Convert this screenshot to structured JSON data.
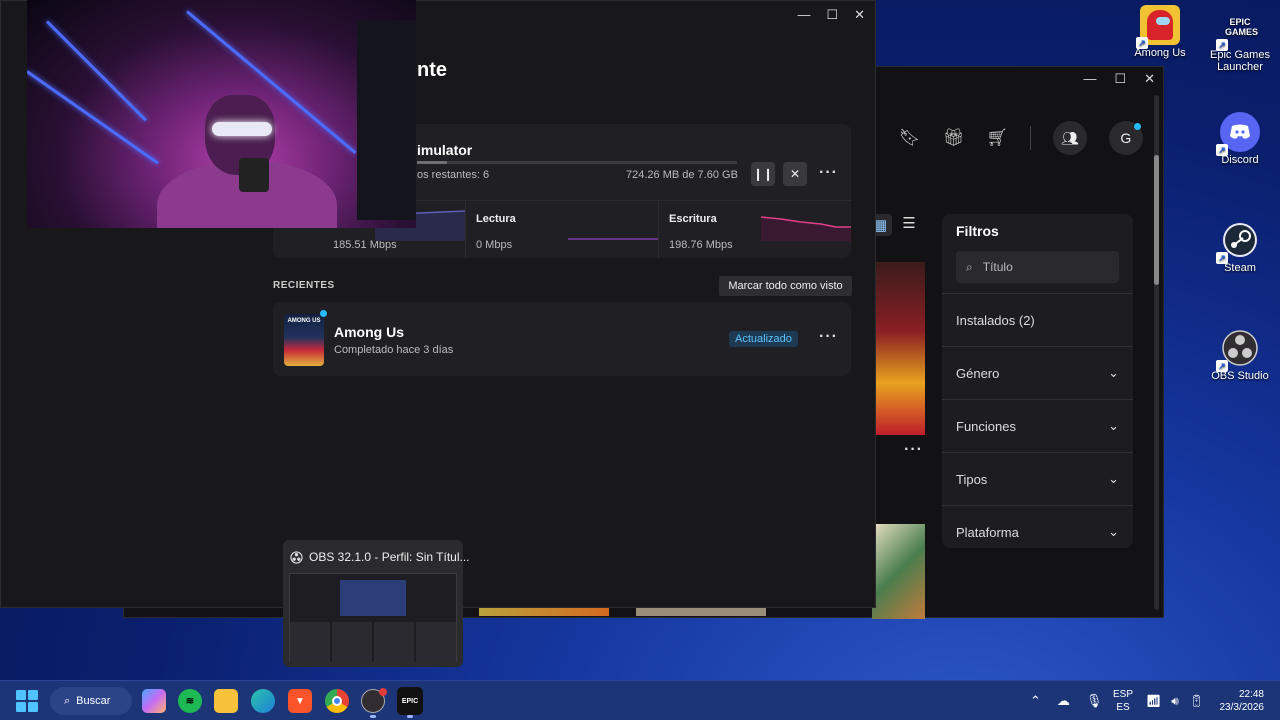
{
  "desktop": {
    "icons": [
      {
        "label": "Among Us",
        "icon": "among-us-icon"
      },
      {
        "label": "Epic Games Launcher",
        "badge": "EPIC GAMES",
        "icon": "epic-games-icon"
      },
      {
        "label": "Discord",
        "icon": "discord-icon"
      },
      {
        "label": "Steam",
        "icon": "steam-icon"
      },
      {
        "label": "OBS Studio",
        "icon": "obs-icon"
      }
    ]
  },
  "epic_library": {
    "avatar_initial": "G",
    "filters": {
      "title": "Filtros",
      "search_placeholder": "Título",
      "installed": "Instalados (2)",
      "sections": [
        "Género",
        "Funciones",
        "Tipos",
        "Plataforma"
      ]
    }
  },
  "downloads": {
    "title_fragment": "nte",
    "active": {
      "name_fragment": "imulator",
      "remaining": "os restantes: 6",
      "size": "724.26 MB de 7.60 GB",
      "progress": 0.095,
      "stats": [
        {
          "label": "",
          "value": "185.51 Mbps"
        },
        {
          "label": "Lectura",
          "value": "0 Mbps"
        },
        {
          "label": "Escritura",
          "value": "198.76 Mbps"
        }
      ]
    },
    "recent_label": "RECIENTES",
    "mark_all_label": "Marcar todo como visto",
    "recent": {
      "title": "Among Us",
      "subtitle": "Completado hace 3 días",
      "badge": "Actualizado",
      "thumb_text": "AMONG US"
    }
  },
  "obs_preview": {
    "title": "OBS 32.1.0 - Perfil: Sin Títul..."
  },
  "taskbar": {
    "search_label": "Buscar",
    "lang_top": "ESP",
    "lang_bottom": "ES",
    "time": "22:48",
    "date": "23/3/2026"
  },
  "colors": {
    "accent": "#26bbff",
    "taskbar": "#1b3577",
    "panel": "#202024"
  }
}
